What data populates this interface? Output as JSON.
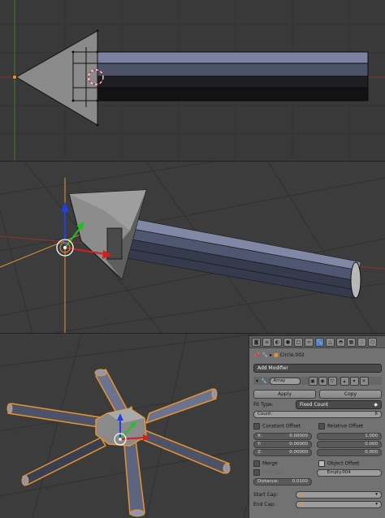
{
  "properties_panel": {
    "object_name": "Circle.002",
    "add_modifier_label": "Add Modifier",
    "modifier_name": "Array",
    "apply_label": "Apply",
    "copy_label": "Copy",
    "fit_type_label": "Fit Type:",
    "fit_type_value": "Fixed Count",
    "count_label": "Count:",
    "count_value": "6",
    "constant_offset_label": "Constant Offset",
    "relative_offset_label": "Relative Offset",
    "constant_offset_x_label": "X:",
    "constant_offset_x_value": "0.00000",
    "constant_offset_y_label": "Y:",
    "constant_offset_y_value": "0.00000",
    "constant_offset_z_label": "Z:",
    "constant_offset_z_value": "0.00000",
    "relative_offset_x_value": "1.000",
    "relative_offset_y_value": "0.000",
    "relative_offset_z_value": "0.000",
    "merge_label": "Merge",
    "first_last_label": "First Last",
    "distance_label": "Distance:",
    "distance_value": "0.0100",
    "object_offset_label": "Object Offset",
    "object_offset_value": "Empty.004",
    "start_cap_label": "Start Cap:",
    "end_cap_label": "End Cap:"
  },
  "colors": {
    "viewport_bg": "#393939",
    "panel_bg": "#727272",
    "selection_outline": "#e8932e",
    "axis_x": "#d02020",
    "axis_y": "#20c020",
    "axis_z": "#2040e0",
    "mesh_blue": "#6a7390"
  }
}
